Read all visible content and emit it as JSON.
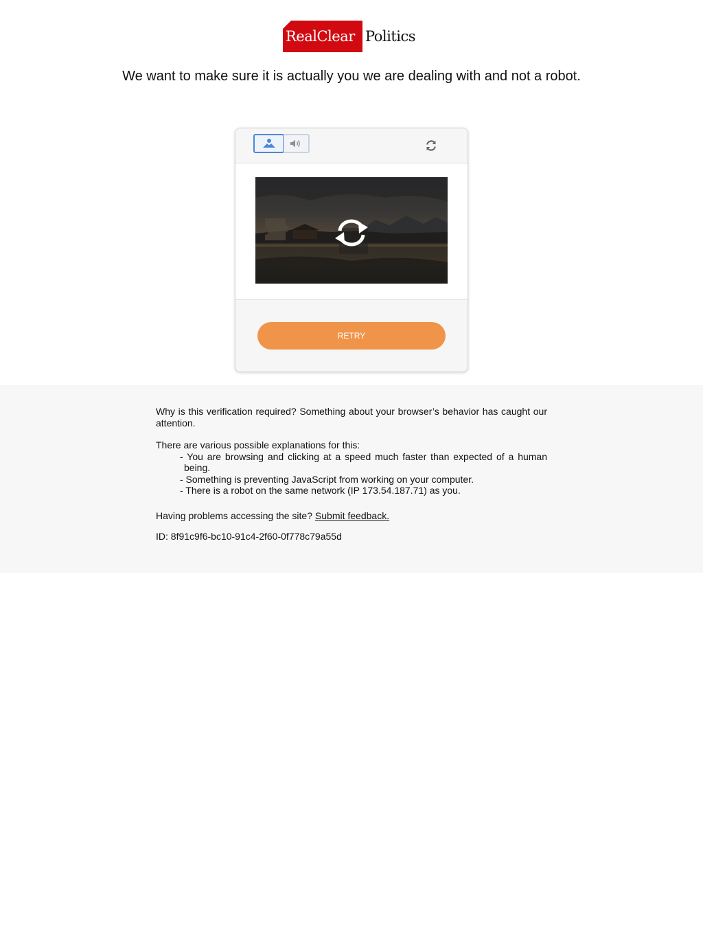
{
  "logo": {
    "part1": "RealClear",
    "part2": "Politics",
    "accent": "#d10a11"
  },
  "headline": "We want to make sure it is actually you we are dealing with and not a robot.",
  "captcha": {
    "mode_image_icon": "image-icon",
    "mode_audio_icon": "speaker-icon",
    "reload_icon": "refresh-icon",
    "center_icon": "refresh-icon",
    "retry_label": "RETRY",
    "retry_color": "#f0944a",
    "selected_color": "#4c87d6"
  },
  "info": {
    "why": "Why is this verification required? Something about your browser’s behavior has caught our attention.",
    "explanations_intro": "There are various possible explanations for this:",
    "reasons": [
      "- You are browsing and clicking at a speed much faster than expected of a human being.",
      "- Something is preventing JavaScript from working on your computer.",
      "- There is a robot on the same network (IP 173.54.187.71) as you."
    ],
    "problems_text": "Having problems accessing the site?",
    "feedback_link": "Submit feedback.",
    "id_text": "ID: 8f91c9f6-bc10-91c4-2f60-0f778c79a55d"
  }
}
